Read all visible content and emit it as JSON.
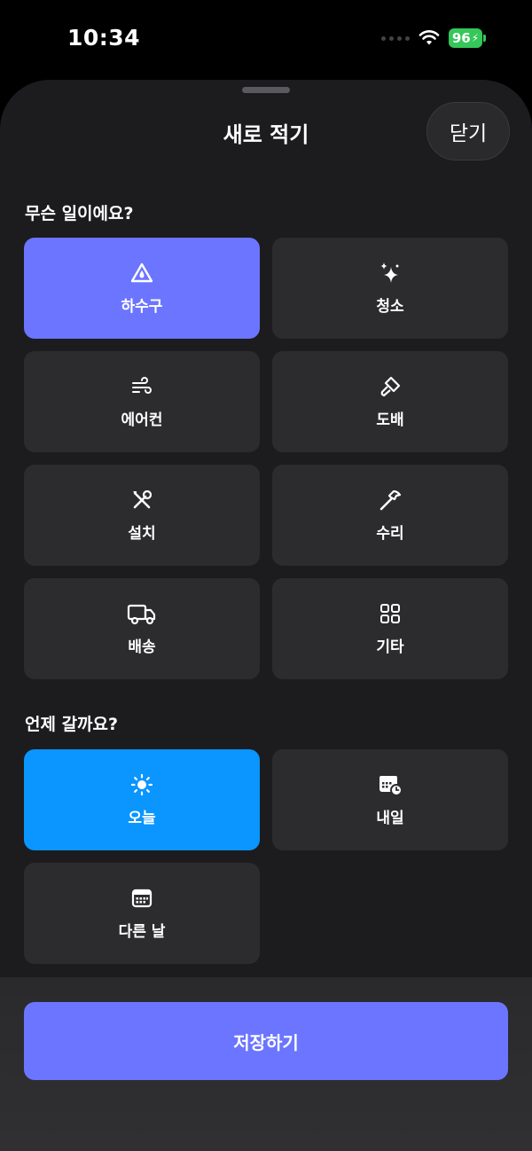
{
  "status": {
    "time": "10:34",
    "battery": "96"
  },
  "header": {
    "title": "새로 적기",
    "close_label": "닫기"
  },
  "category": {
    "label": "무슨 일이에요?",
    "items": [
      {
        "label": "하수구",
        "icon": "drain-icon"
      },
      {
        "label": "청소",
        "icon": "sparkles-icon"
      },
      {
        "label": "에어컨",
        "icon": "wind-icon"
      },
      {
        "label": "도배",
        "icon": "paint-brush-icon"
      },
      {
        "label": "설치",
        "icon": "wrench-screwdriver-icon"
      },
      {
        "label": "수리",
        "icon": "hammer-icon"
      },
      {
        "label": "배송",
        "icon": "truck-icon"
      },
      {
        "label": "기타",
        "icon": "grid-icon"
      }
    ],
    "selected": "하수구"
  },
  "when": {
    "label": "언제 갈까요?",
    "items": [
      {
        "label": "오늘",
        "icon": "sun-icon"
      },
      {
        "label": "내일",
        "icon": "calendar-clock-icon"
      },
      {
        "label": "다른 날",
        "icon": "calendar-icon"
      }
    ],
    "selected": "오늘"
  },
  "footer": {
    "save_label": "저장하기"
  },
  "colors": {
    "accent": "#6b75ff",
    "today": "#0a95ff",
    "tile": "#2c2c2e",
    "sheet": "#1c1c1e"
  }
}
